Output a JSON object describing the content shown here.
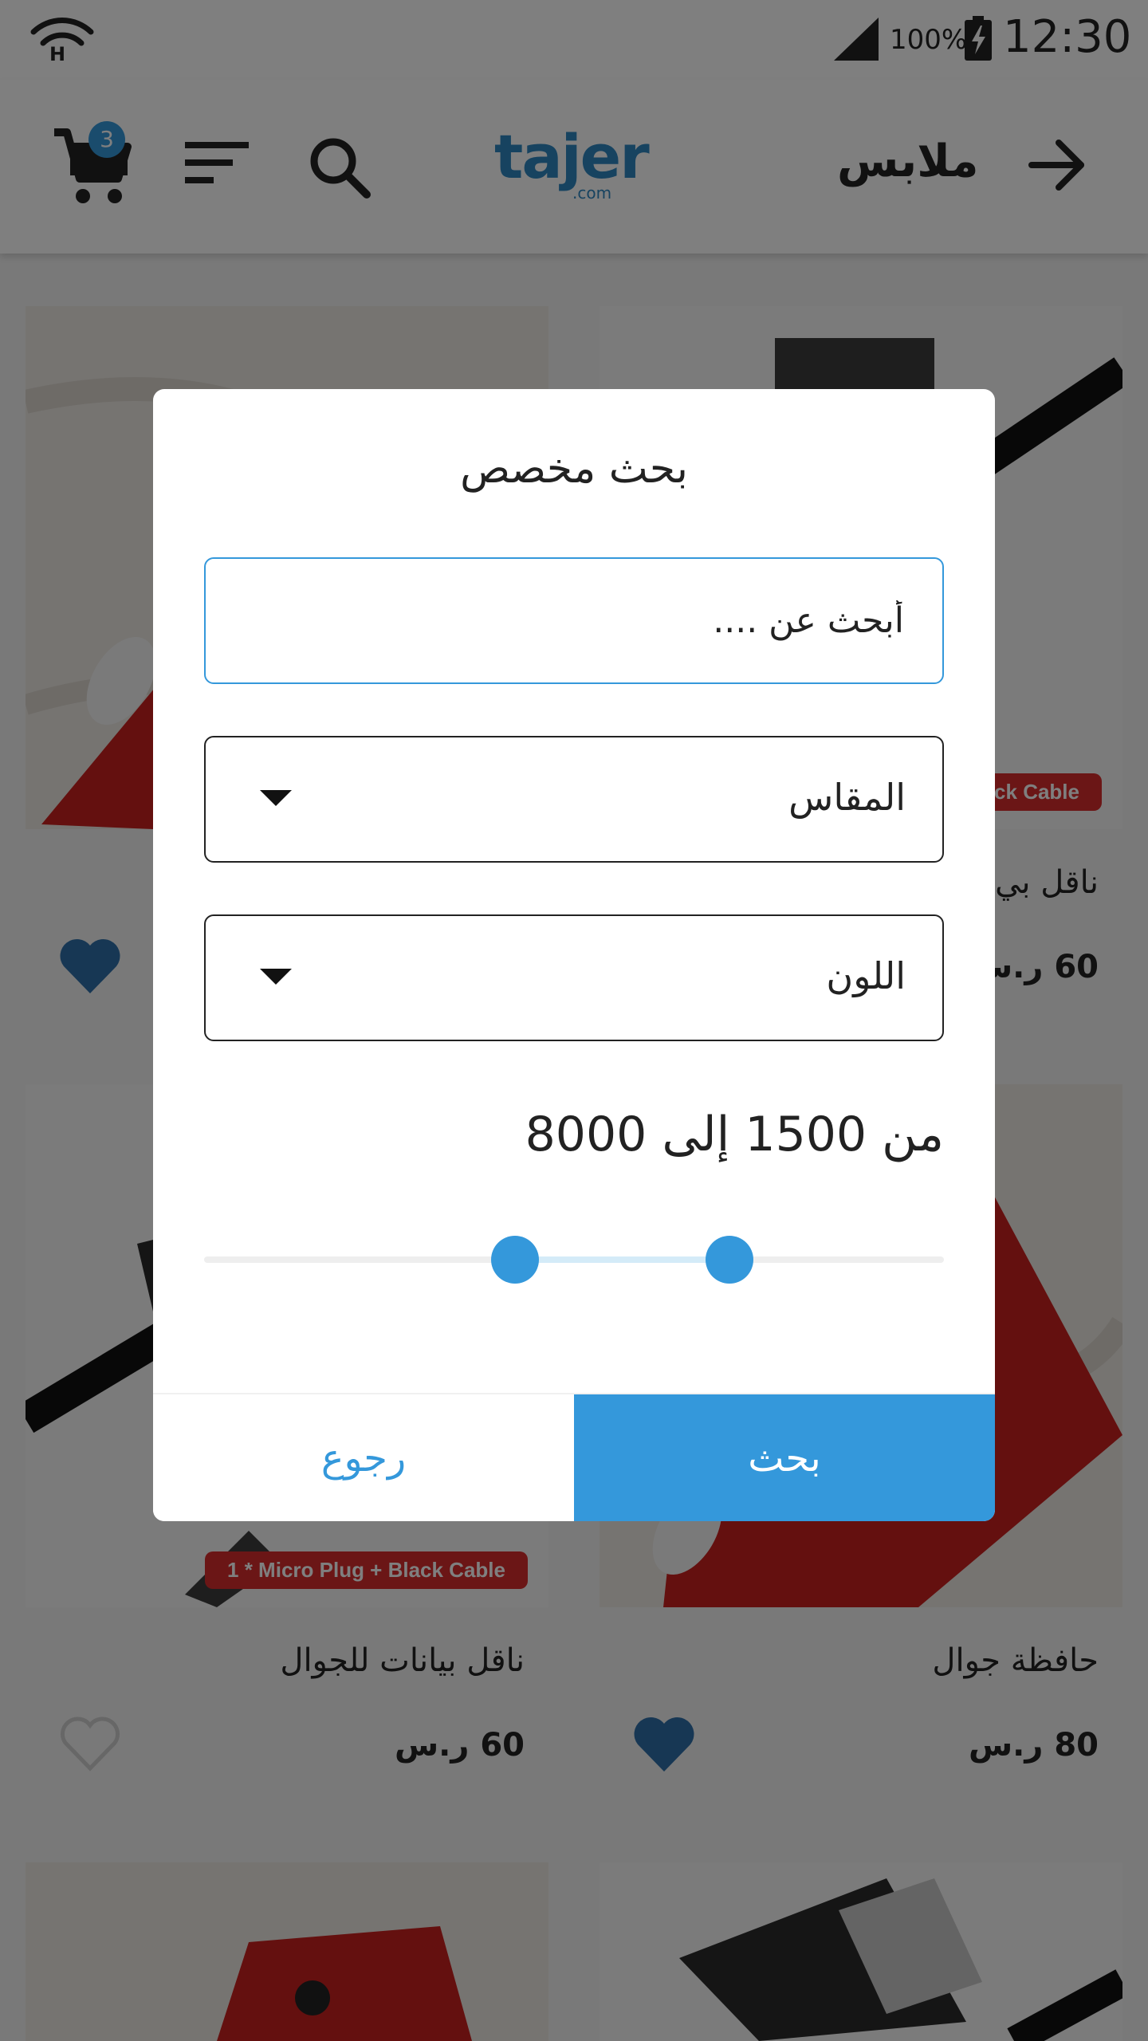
{
  "status_bar": {
    "battery_percent": "100%",
    "time": "12:30"
  },
  "header": {
    "title": "ملابس",
    "cart_count": "3",
    "logo": "tajer",
    "logo_suffix": ".com",
    "icons": [
      "back-arrow-icon",
      "search-icon",
      "filter-icon",
      "cart-icon"
    ]
  },
  "products": [
    {
      "name": "ناقل بي",
      "price": "60 ر.س",
      "favorite": true,
      "tag": "ck Cable"
    },
    {
      "name": "",
      "price": "",
      "favorite": true
    },
    {
      "name": "حافظة جوال",
      "price": "80 ر.س",
      "favorite": true
    },
    {
      "name": "ناقل بيانات للجوال",
      "price": "60 ر.س",
      "favorite": false,
      "tag": "1 * Micro Plug + Black Cable"
    }
  ],
  "dialog": {
    "title": "بحث مخصص",
    "search_placeholder": "أبحث عن ....",
    "size_label": "المقاس",
    "color_label": "اللون",
    "range_text": "من 1500 إلى 8000",
    "range_min": 1500,
    "range_max": 8000,
    "slider_low_fraction": 0.42,
    "slider_high_fraction": 0.71,
    "search_button": "بحث",
    "back_button": "رجوع"
  },
  "colors": {
    "accent": "#3498db",
    "tag_red": "#d62d2d",
    "heart_blue": "#2e6fa8"
  }
}
